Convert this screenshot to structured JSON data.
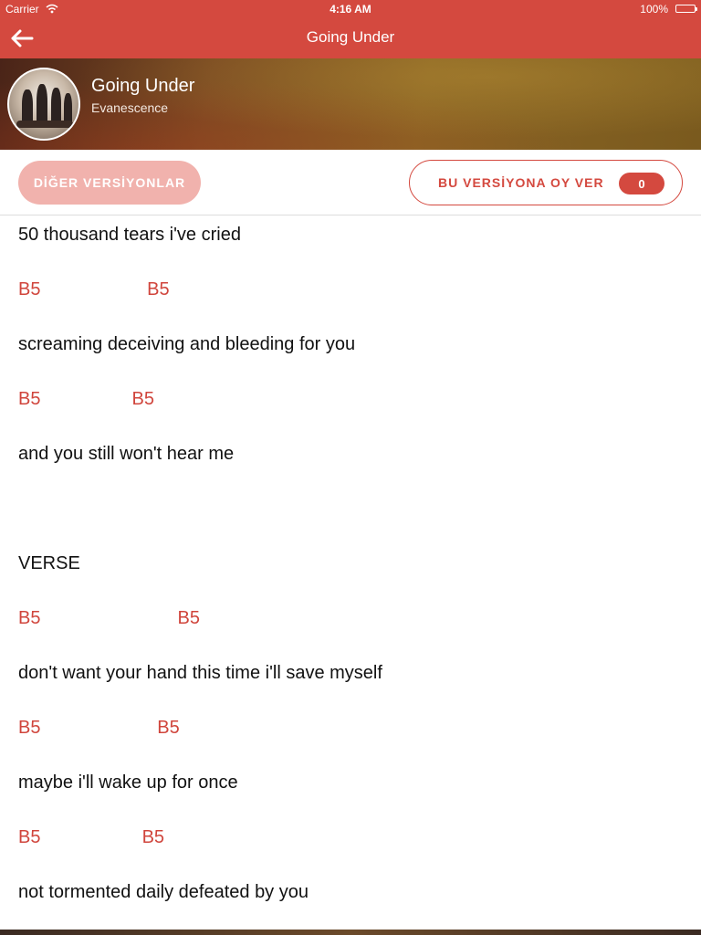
{
  "status_bar": {
    "carrier": "Carrier",
    "time": "4:16 AM",
    "battery": "100%",
    "battery_level": 1.0
  },
  "nav": {
    "title": "Going Under",
    "back_icon": "arrow-left-icon"
  },
  "header": {
    "song_title": "Going Under",
    "artist": "Evanescence"
  },
  "buttons": {
    "other_versions": "DİĞER VERSİYONLAR",
    "vote": "BU VERSİYONA OY VER",
    "vote_count": "0"
  },
  "colors": {
    "accent": "#d4493f",
    "chord": "#d0453c",
    "other_versions_bg": "#f1b2ad"
  },
  "lyrics": [
    {
      "type": "text",
      "text": "50 thousand tears i've cried"
    },
    {
      "type": "chord",
      "text": "B5                     B5"
    },
    {
      "type": "text",
      "text": "screaming deceiving and bleeding for you"
    },
    {
      "type": "chord",
      "text": "B5                  B5"
    },
    {
      "type": "text",
      "text": "and you still won't hear me"
    },
    {
      "type": "text",
      "text": ""
    },
    {
      "type": "text",
      "text": "VERSE"
    },
    {
      "type": "chord",
      "text": "B5                           B5"
    },
    {
      "type": "text",
      "text": "don't want your hand this time i'll save myself"
    },
    {
      "type": "chord",
      "text": "B5                       B5"
    },
    {
      "type": "text",
      "text": "maybe i'll wake up for once"
    },
    {
      "type": "chord",
      "text": "B5                    B5"
    },
    {
      "type": "text",
      "text": "not tormented daily defeated by you"
    }
  ]
}
